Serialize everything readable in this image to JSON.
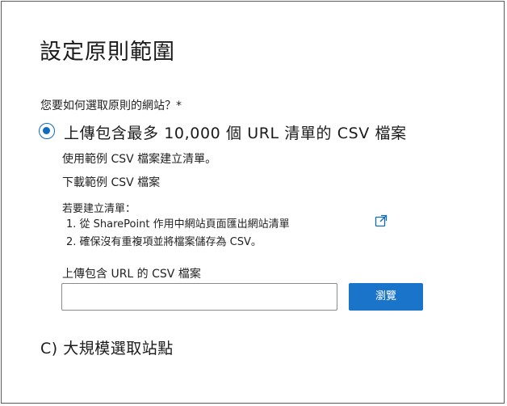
{
  "dialog": {
    "title": "設定原則範圍",
    "question": "您要如何選取原則的網站？*",
    "option_upload": {
      "label": "上傳包含最多 10,000 個 URL 清單的 CSV 檔案",
      "selected": true,
      "description": "使用範例 CSV 檔案建立清單。",
      "download_link": "下載範例 CSV 檔案",
      "instructions_heading": "若要建立清單：",
      "steps": [
        "1. 從 SharePoint 作用中網站頁面匯出網站清單",
        "2. 確保沒有重複項並將檔案儲存為 CSV。"
      ],
      "external_link_icon": "external-link-icon",
      "upload_label": "上傳包含 URL 的 CSV 檔案",
      "file_input_value": "",
      "browse_button": "瀏覽"
    },
    "option_bulk": {
      "label": "C) 大規模選取站點"
    }
  },
  "colors": {
    "accent": "#0f6cbd",
    "button_bg": "#1a74c9",
    "border": "#5a5a5a"
  }
}
